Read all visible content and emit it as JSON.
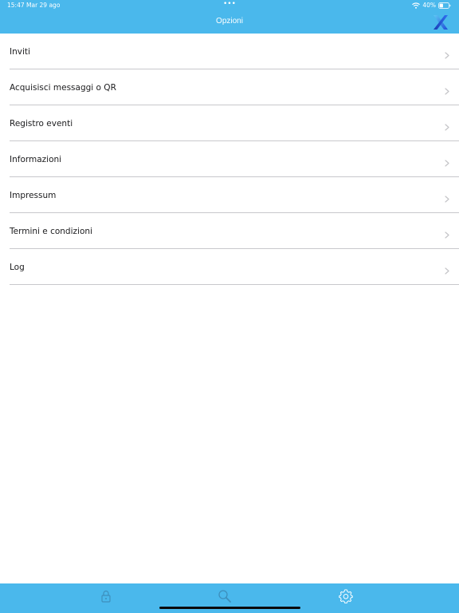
{
  "status_bar": {
    "time": "15:47",
    "date": "Mar 29 ago",
    "multitask_dots": "•••",
    "battery_percent": "40%",
    "battery_level": 0.4,
    "icons": [
      "wifi-icon",
      "battery-icon"
    ]
  },
  "nav": {
    "title": "Opzioni",
    "logo_icon": "brand-x-logo-icon"
  },
  "menu": {
    "items": [
      {
        "label": "Inviti",
        "icon": "chevron-right-icon"
      },
      {
        "label": "Acquisisci messaggi o QR",
        "icon": "chevron-right-icon"
      },
      {
        "label": "Registro eventi",
        "icon": "chevron-right-icon"
      },
      {
        "label": "Informazioni",
        "icon": "chevron-right-icon"
      },
      {
        "label": "Impressum",
        "icon": "chevron-right-icon"
      },
      {
        "label": "Termini e condizioni",
        "icon": "chevron-right-icon"
      },
      {
        "label": "Log",
        "icon": "chevron-right-icon"
      }
    ]
  },
  "tab_bar": {
    "tabs": [
      {
        "icon": "lock-icon",
        "selected": false
      },
      {
        "icon": "search-icon",
        "selected": false
      },
      {
        "icon": "settings-gear-icon",
        "selected": true
      }
    ]
  },
  "colors": {
    "accent": "#4ab8ec",
    "text": "#1c1c1e",
    "separator": "#c8c8cc",
    "chevron": "#c4c4c7",
    "tab_inactive": "#3d8fbc",
    "tab_active": "#ffffff"
  }
}
